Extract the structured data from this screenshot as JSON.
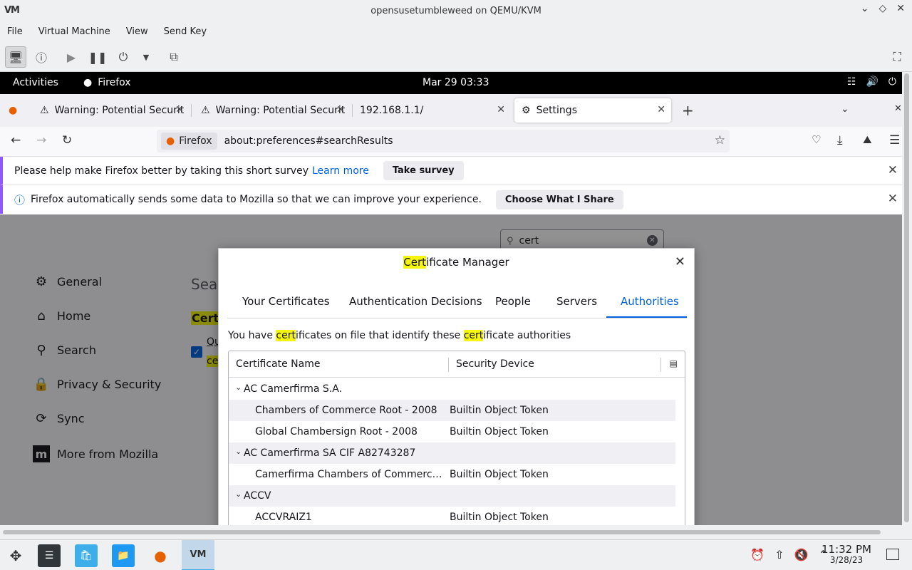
{
  "vm_window": {
    "title": "opensusetumbleweed on QEMU/KVM",
    "logo": "VM",
    "menu": [
      "File",
      "Virtual Machine",
      "View",
      "Send Key"
    ]
  },
  "gnome": {
    "activities": "Activities",
    "app_name": "Firefox",
    "clock": "Mar 29  03:33"
  },
  "tabs": [
    {
      "label": "Warning: Potential Securit",
      "icon": "warning-icon"
    },
    {
      "label": "Warning: Potential Securit",
      "icon": "warning-icon"
    },
    {
      "label": "192.168.1.1/",
      "icon": ""
    },
    {
      "label": "Settings",
      "icon": "gear-icon"
    }
  ],
  "urlbar": {
    "identity": "Firefox",
    "url": "about:preferences#searchResults"
  },
  "notifications": {
    "survey_text": "Please help make Firefox better by taking this short survey",
    "survey_link": "Learn more",
    "survey_button": "Take survey",
    "data_text": "Firefox automatically sends some data to Mozilla so that we can improve your experience.",
    "data_button": "Choose What I Share"
  },
  "settings": {
    "search_value": "cert",
    "categories": [
      "General",
      "Home",
      "Search",
      "Privacy & Security",
      "Sync",
      "More from Mozilla"
    ],
    "partial_heading": "Sear",
    "partial_cert": "Certi",
    "partial_q": "Qu",
    "partial_ce": "ce"
  },
  "dialog": {
    "title_highlight": "Cert",
    "title_rest": "ificate Manager",
    "tabs": [
      "Your Certificates",
      "Authentication Decisions",
      "People",
      "Servers",
      "Authorities"
    ],
    "selected_tab": "Authorities",
    "desc_1": "You have ",
    "desc_hl1": "cert",
    "desc_2": "ificates on file that identify these ",
    "desc_hl2": "cert",
    "desc_3": "ificate authorities",
    "columns": [
      "Certificate Name",
      "Security Device"
    ],
    "rows": [
      {
        "type": "group",
        "name": "AC Camerfirma S.A."
      },
      {
        "type": "cert",
        "name": "Chambers of Commerce Root - 2008",
        "device": "Builtin Object Token"
      },
      {
        "type": "cert",
        "name": "Global Chambersign Root - 2008",
        "device": "Builtin Object Token"
      },
      {
        "type": "group",
        "name": "AC Camerfirma SA CIF A82743287"
      },
      {
        "type": "cert",
        "name": "Camerfirma Chambers of Commerce Root",
        "device": "Builtin Object Token"
      },
      {
        "type": "group",
        "name": "ACCV"
      },
      {
        "type": "cert",
        "name": "ACCVRAIZ1",
        "device": "Builtin Object Token"
      }
    ]
  },
  "host_clock": {
    "time": "11:32 PM",
    "date": "3/28/23"
  },
  "colors": {
    "accent": "#0061e0",
    "highlight": "#f5f50f",
    "notif_border": "#9059ff"
  }
}
